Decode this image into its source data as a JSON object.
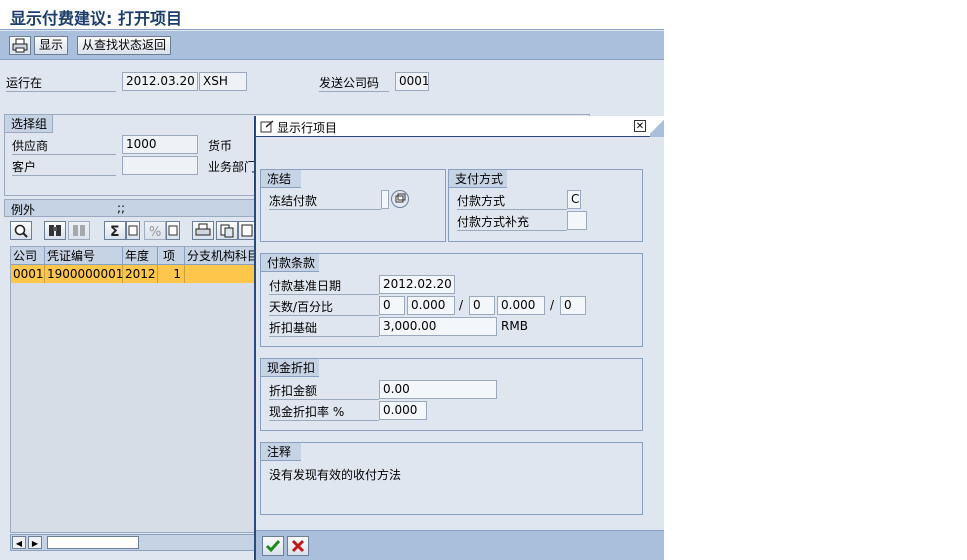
{
  "window": {
    "title": "显示付费建议: 打开项目"
  },
  "toolbar": {
    "display": "显示",
    "return_from_search": "从查找状态返回"
  },
  "run": {
    "run_on_label": "运行在",
    "run_date": "2012.03.20",
    "run_id": "XSH",
    "sending_company_label": "发送公司码",
    "sending_company": "0001"
  },
  "selection_group": {
    "title": "选择组",
    "vendor_label": "供应商",
    "vendor_value": "1000",
    "customer_label": "客户",
    "customer_value": "",
    "currency_label": "货币",
    "business_area_label": "业务部门"
  },
  "exceptions": {
    "title": "例外",
    "suffix": ";;",
    "columns": [
      "公司",
      "凭证编号",
      "年度",
      "项",
      "分支机构科目"
    ],
    "rows": [
      {
        "company": "0001",
        "doc_no": "1900000001",
        "year": "2012",
        "item": "1",
        "branch": ""
      }
    ]
  },
  "popup": {
    "title": "显示行项目",
    "freeze": {
      "title": "冻结",
      "block_label": "冻结付款",
      "block_value": ""
    },
    "payment_method": {
      "title": "支付方式",
      "method_label": "付款方式",
      "method_value": "C",
      "supplement_label": "付款方式补充",
      "supplement_value": ""
    },
    "payment_terms": {
      "title": "付款条款",
      "baseline_label": "付款基准日期",
      "baseline_value": "2012.02.20",
      "days_label": "天数/百分比",
      "days1": "0",
      "pct1": "0.000",
      "days2": "0",
      "pct2": "0.000",
      "days3": "0",
      "slash": "/",
      "discount_base_label": "折扣基础",
      "discount_base_value": "3,000.00",
      "currency": "RMB"
    },
    "cash_discount": {
      "title": "现金折扣",
      "amount_label": "折扣金额",
      "amount_value": "0.00",
      "rate_label": "现金折扣率 %",
      "rate_value": "0.000"
    },
    "notes": {
      "title": "注释",
      "text": "没有发现有效的收付方法"
    }
  },
  "colors": {
    "title_blue": "#1d3d6c",
    "selected_row": "#ffc64c",
    "toolbar": "#a9bfdc"
  }
}
